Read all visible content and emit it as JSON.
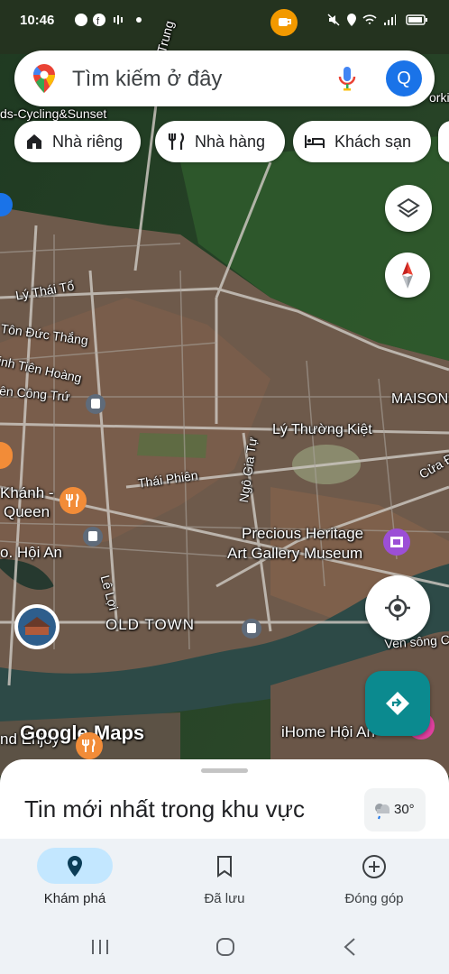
{
  "status_bar": {
    "time": "10:46"
  },
  "search": {
    "placeholder": "Tìm kiếm ở đây",
    "avatar_letter": "Q"
  },
  "chips": [
    {
      "label": "Nhà riêng",
      "icon": "home-icon"
    },
    {
      "label": "Nhà hàng",
      "icon": "restaurant-icon"
    },
    {
      "label": "Khách sạn",
      "icon": "hotel-icon"
    }
  ],
  "map_labels": {
    "cycling": "ds-Cycling&Sunset",
    "ly_thai_to": "Lý Thái Tổ",
    "ton_duc_thang": "Tôn Đức Thắng",
    "tien_hoang": "inh Tiên Hoàng",
    "cong_tru": "ên Công Trứ",
    "maison": "MAISON",
    "ly_thuong_kiet": "Lý Thường Kiệt",
    "ngo_gia_tu": "Ngô Gia Tự",
    "thai_phien": "Thái Phiên",
    "cua_dai": "Cửa Đ",
    "khanh": "Khánh -",
    "queen": "Queen",
    "hoi_an": "o. Hội An",
    "le_loi": "Lê Lợi",
    "precious_1": "Precious Heritage",
    "precious_2": "Art Gallery Museum",
    "old_town": "OLD TOWN",
    "ven_song": "Ven sông Cá",
    "trung": "Trung",
    "orki": "orki",
    "google_maps": "Google Maps",
    "nd_enjoy": "nd Enjoy",
    "ihome": "iHome Hội An"
  },
  "sheet": {
    "title": "Tin mới nhất trong khu vực",
    "weather_temp": "30°"
  },
  "bottom_nav": [
    {
      "label": "Khám phá",
      "icon": "explore-pin-icon",
      "active": true
    },
    {
      "label": "Đã lưu",
      "icon": "bookmark-icon",
      "active": false
    },
    {
      "label": "Đóng góp",
      "icon": "add-circle-icon",
      "active": false
    }
  ],
  "colors": {
    "accent": "#1a73e8",
    "directions": "#0b8a8f",
    "active_pill": "#c3e7ff"
  }
}
